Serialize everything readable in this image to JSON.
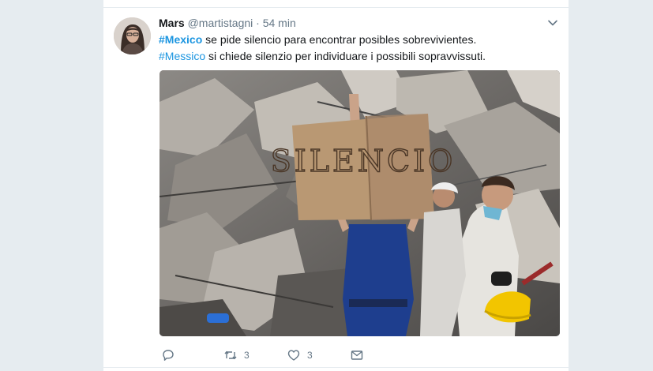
{
  "tweet": {
    "author": {
      "name": "Mars",
      "handle": "@martistagni",
      "separator": "·",
      "time": "54 min",
      "avatar_icon": "user-avatar"
    },
    "line1": {
      "hashtag": "#Mexico",
      "text": " se pide silencio para encontrar posibles sobrevivientes."
    },
    "line2": {
      "hashtag": "#Messico",
      "text": " si chiede silenzio per individuare i possibili sopravvissuti."
    },
    "media": {
      "sign_text": "SILENCIO"
    },
    "actions": {
      "reply_icon": "reply-icon",
      "retweet_count": "3",
      "like_count": "3",
      "message_icon": "envelope-icon"
    }
  },
  "colors": {
    "background": "#e6ecf0",
    "text": "#14171a",
    "muted": "#657786",
    "link": "#1b95e0"
  }
}
